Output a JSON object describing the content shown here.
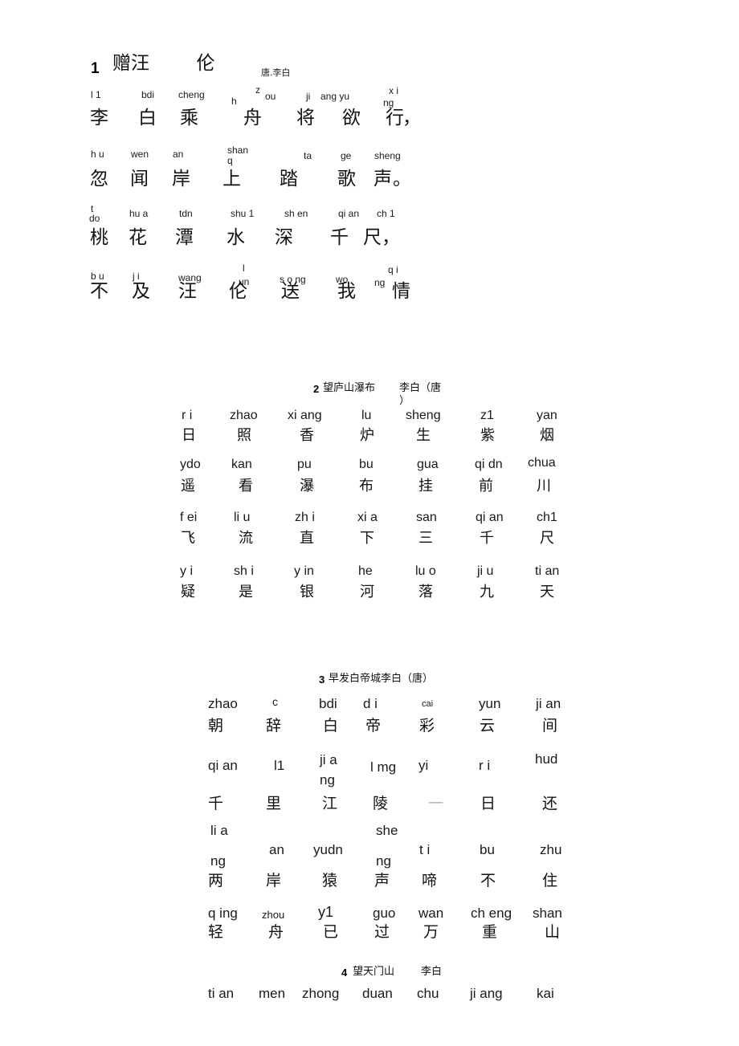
{
  "document": {
    "kind": "scanned-poem-worksheet",
    "background_color": "#ffffff",
    "text_color": "#1a1a1a"
  },
  "poems": [
    {
      "number": "1",
      "title_han": "赠汪        伦",
      "byline": "唐.李白",
      "lines": [
        {
          "pinyin": [
            "l 1",
            "bdi",
            "cheng",
            "h",
            "z",
            "ou",
            "ji",
            "ang yu",
            "ng",
            "x i"
          ],
          "han": [
            "李",
            "白",
            "乘",
            "舟",
            "将",
            "欲",
            "行",
            "，"
          ]
        },
        {
          "pinyin": [
            "h u",
            "wen",
            "an",
            "shan",
            "q",
            "ta",
            "ge",
            "sheng"
          ],
          "han": [
            "忽",
            "闻",
            "岸",
            "上",
            "踏",
            "歌",
            "声",
            "。"
          ]
        },
        {
          "pinyin": [
            "t",
            "do",
            "hu a",
            "tdn",
            "shu 1",
            "sh en",
            "qi an",
            "ch 1"
          ],
          "han": [
            "桃",
            "花",
            "潭",
            "水",
            "深",
            "千",
            "尺",
            "，"
          ]
        },
        {
          "pinyin": [
            "b u",
            "j i",
            "wang",
            "l",
            "un",
            "s o ng",
            "wo",
            "ng",
            "q i"
          ],
          "han": [
            "不",
            "及",
            "汪",
            "伦",
            "送",
            "我",
            "情"
          ]
        }
      ]
    },
    {
      "number": "2",
      "title_han": "望庐山瀑布",
      "title_author": "李白（唐",
      "title_author_tail": "）",
      "rows": [
        {
          "pinyin": [
            "r i",
            "zhao",
            "xi ang",
            "lu",
            "sheng",
            "z1",
            "yan"
          ],
          "han": [
            "日",
            "照",
            "香",
            "炉",
            "生",
            "紫",
            "烟"
          ]
        },
        {
          "pinyin": [
            "ydo",
            "kan",
            "pu",
            "bu",
            "gua",
            "qi dn",
            "chua"
          ],
          "han": [
            "遥",
            "看",
            "瀑",
            "布",
            "挂",
            "前",
            "川"
          ]
        },
        {
          "pinyin": [
            "f ei",
            "li u",
            "zh i",
            "xi a",
            "san",
            "qi an",
            "ch1"
          ],
          "han": [
            "飞",
            "流",
            "直",
            "下",
            "三",
            "千",
            "尺"
          ]
        },
        {
          "pinyin": [
            "y i",
            "sh i",
            "y in",
            "he",
            "lu o",
            "ji u",
            "ti an"
          ],
          "han": [
            "疑",
            "是",
            "银",
            "河",
            "落",
            "九",
            "天"
          ]
        }
      ]
    },
    {
      "number": "3",
      "title_han": "早发白帝城李白（唐）",
      "rows": [
        {
          "pinyin": [
            "zhao",
            "c",
            "bdi",
            "d i",
            "cai",
            "yun",
            "ji an"
          ],
          "han": [
            "朝",
            "辞",
            "白",
            "帝",
            "彩",
            "云",
            "间"
          ]
        },
        {
          "pinyin": [
            "qi an",
            "l1",
            "ji a",
            "ng",
            "l mg",
            "yi",
            "r i",
            "hud"
          ],
          "han": [
            "千",
            "里",
            "江",
            "陵",
            "一",
            "日",
            "还"
          ]
        },
        {
          "pinyin": [
            "li a",
            "ng",
            "an",
            "yudn",
            "she",
            "ng",
            "t i",
            "bu",
            "zhu"
          ],
          "han": [
            "两",
            "岸",
            "猿",
            "声",
            "啼",
            "不",
            "住"
          ]
        },
        {
          "pinyin": [
            "q ing",
            "zhou",
            "y1",
            "guo",
            "wan",
            "ch eng",
            "shan"
          ],
          "han": [
            "轻",
            "舟",
            "已",
            "过",
            "万",
            "重",
            "山"
          ]
        }
      ]
    },
    {
      "number": "4",
      "title_han": "望天门山",
      "title_author": "李白",
      "rows": [
        {
          "pinyin": [
            "ti an",
            "men",
            "zhong",
            "duan",
            "chu",
            "ji ang",
            "kai"
          ],
          "han": []
        }
      ]
    }
  ]
}
